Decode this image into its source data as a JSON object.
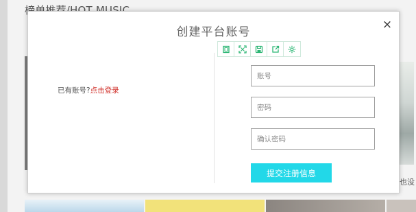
{
  "background": {
    "section_title": "榜单推荐/HOT MUSIC",
    "right_text": "也没"
  },
  "modal": {
    "title": "创建平台账号",
    "close_label": "×",
    "login_prompt": "已有账号?",
    "login_link": "点击登录",
    "toolbar": {
      "icons": [
        "window-icon",
        "fullscreen-icon",
        "save-icon",
        "share-icon",
        "settings-icon"
      ],
      "accent_color": "#2bb673"
    },
    "fields": {
      "account_placeholder": "账号",
      "password_placeholder": "密码",
      "confirm_placeholder": "确认密码"
    },
    "submit_label": "提交注册信息",
    "submit_color": "#22d8e8"
  }
}
